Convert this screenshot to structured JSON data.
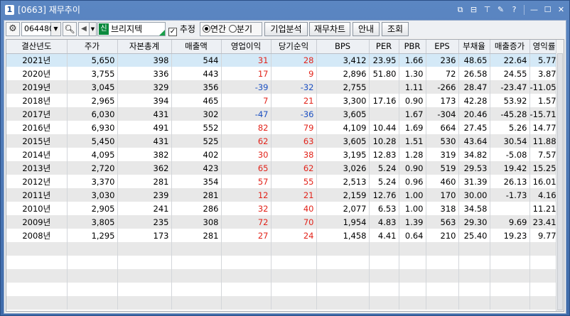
{
  "window": {
    "number": "1",
    "title": "[0663] 재무추이",
    "buttons": [
      {
        "name": "pop-out-icon",
        "glyph": "⧉"
      },
      {
        "name": "link-icon",
        "glyph": "⊟"
      },
      {
        "name": "pin-icon",
        "glyph": "⊤"
      },
      {
        "name": "settings-icon",
        "glyph": "✎"
      },
      {
        "name": "help-icon",
        "glyph": "?"
      },
      {
        "name": "minimize-icon",
        "glyph": "—"
      },
      {
        "name": "maximize-icon",
        "glyph": "☐"
      },
      {
        "name": "close-icon",
        "glyph": "✕"
      }
    ]
  },
  "toolbar": {
    "code": "064480",
    "badge": "신",
    "stock_name": "브리지텍",
    "estimate_label": "추정",
    "annual_label": "연간",
    "quarterly_label": "분기",
    "company_analysis": "기업분석",
    "financial_chart": "재무차트",
    "guide": "안내",
    "inquiry": "조회"
  },
  "table": {
    "headers": [
      "결산년도",
      "주가",
      "자본총계",
      "매출액",
      "영업이익",
      "당기순익",
      "BPS",
      "PER",
      "PBR",
      "EPS",
      "부채율",
      "매출증가",
      "영익률"
    ],
    "rows": [
      [
        "2021년",
        "5,650",
        "398",
        "544",
        "31",
        "28",
        "3,412",
        "23.95",
        "1.66",
        "236",
        "48.65",
        "22.64",
        "5.77"
      ],
      [
        "2020년",
        "3,755",
        "336",
        "443",
        "17",
        "9",
        "2,896",
        "51.80",
        "1.30",
        "72",
        "26.58",
        "24.55",
        "3.87"
      ],
      [
        "2019년",
        "3,045",
        "329",
        "356",
        "-39",
        "-32",
        "2,755",
        "",
        "1.11",
        "-266",
        "28.47",
        "-23.47",
        "-11.05"
      ],
      [
        "2018년",
        "2,965",
        "394",
        "465",
        "7",
        "21",
        "3,300",
        "17.16",
        "0.90",
        "173",
        "42.28",
        "53.92",
        "1.57"
      ],
      [
        "2017년",
        "6,030",
        "431",
        "302",
        "-47",
        "-36",
        "3,605",
        "",
        "1.67",
        "-304",
        "20.46",
        "-45.28",
        "-15.71"
      ],
      [
        "2016년",
        "6,930",
        "491",
        "552",
        "82",
        "79",
        "4,109",
        "10.44",
        "1.69",
        "664",
        "27.45",
        "5.26",
        "14.77"
      ],
      [
        "2015년",
        "5,450",
        "431",
        "525",
        "62",
        "63",
        "3,605",
        "10.28",
        "1.51",
        "530",
        "43.64",
        "30.54",
        "11.88"
      ],
      [
        "2014년",
        "4,095",
        "382",
        "402",
        "30",
        "38",
        "3,195",
        "12.83",
        "1.28",
        "319",
        "34.82",
        "-5.08",
        "7.57"
      ],
      [
        "2013년",
        "2,720",
        "362",
        "423",
        "65",
        "62",
        "3,026",
        "5.24",
        "0.90",
        "519",
        "29.53",
        "19.42",
        "15.25"
      ],
      [
        "2012년",
        "3,370",
        "281",
        "354",
        "57",
        "55",
        "2,513",
        "5.24",
        "0.96",
        "460",
        "31.39",
        "26.13",
        "16.01"
      ],
      [
        "2011년",
        "3,030",
        "239",
        "281",
        "12",
        "21",
        "2,159",
        "12.76",
        "1.00",
        "170",
        "30.00",
        "-1.73",
        "4.16"
      ],
      [
        "2010년",
        "2,905",
        "241",
        "286",
        "32",
        "40",
        "2,077",
        "6.53",
        "1.00",
        "318",
        "34.58",
        "",
        "11.21"
      ],
      [
        "2009년",
        "3,805",
        "235",
        "308",
        "72",
        "70",
        "1,954",
        "4.83",
        "1.39",
        "563",
        "29.30",
        "9.69",
        "23.41"
      ],
      [
        "2008년",
        "1,295",
        "173",
        "281",
        "27",
        "24",
        "1,458",
        "4.41",
        "0.64",
        "210",
        "25.40",
        "19.23",
        "9.77"
      ]
    ],
    "empty_rows": 5,
    "selected_row": 0,
    "colored_columns": [
      4,
      5
    ]
  },
  "colors": {
    "positive": "#e2231a",
    "negative": "#1b4fc1",
    "selected_row": "#d4e9f7",
    "title_bar": "#4a76b0"
  }
}
